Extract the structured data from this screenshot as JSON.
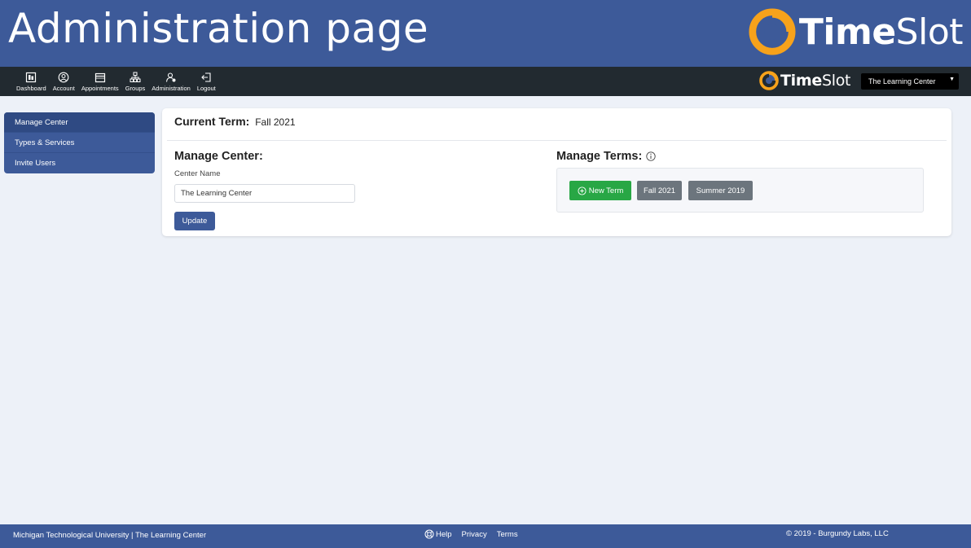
{
  "banner": {
    "title": "Administration page",
    "logo_bold": "Time",
    "logo_light": "Slot"
  },
  "nav": {
    "items": [
      {
        "label": "Dashboard",
        "icon": "dashboard-icon"
      },
      {
        "label": "Account",
        "icon": "account-icon"
      },
      {
        "label": "Appointments",
        "icon": "appointments-icon"
      },
      {
        "label": "Groups",
        "icon": "groups-icon"
      },
      {
        "label": "Administration",
        "icon": "administration-icon"
      },
      {
        "label": "Logout",
        "icon": "logout-icon"
      }
    ],
    "logo_bold": "Time",
    "logo_light": "Slot",
    "center_select": "The Learning Center"
  },
  "sidebar": {
    "items": [
      {
        "label": "Manage Center"
      },
      {
        "label": "Types & Services"
      },
      {
        "label": "Invite Users"
      }
    ]
  },
  "card": {
    "current_term_label": "Current Term:",
    "current_term_value": "Fall 2021",
    "manage_center": {
      "title": "Manage Center:",
      "name_label": "Center Name",
      "name_value": "The Learning Center",
      "update_label": "Update"
    },
    "manage_terms": {
      "title": "Manage Terms:",
      "new_term_label": "New Term",
      "terms": [
        "Fall 2021",
        "Summer 2019"
      ]
    }
  },
  "footer": {
    "left": "Michigan Technological University | The Learning Center",
    "help": "Help",
    "privacy": "Privacy",
    "terms": "Terms",
    "copyright": "© 2019 - Burgundy Labs, LLC"
  },
  "colors": {
    "primary": "#3d5a99",
    "nav_bg": "#222a30",
    "success": "#28a745",
    "secondary": "#6c757d",
    "logo_orange": "#f7a21b",
    "page_bg": "#edf1f8"
  }
}
